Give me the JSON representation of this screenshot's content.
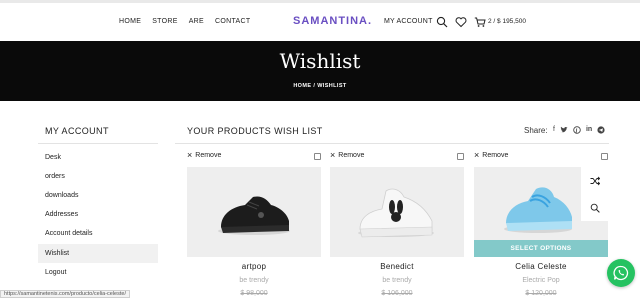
{
  "header": {
    "nav": [
      "HOME",
      "STORE",
      "ARE",
      "CONTACT"
    ],
    "logo": "SAMANTINA.",
    "account_label": "MY ACCOUNT",
    "cart_summary": "2 / $ 195,500"
  },
  "banner": {
    "title": "Wishlist",
    "breadcrumb": "HOME  /  WISHLIST"
  },
  "sidebar": {
    "title": "MY ACCOUNT",
    "items": [
      {
        "label": "Desk"
      },
      {
        "label": "orders"
      },
      {
        "label": "downloads"
      },
      {
        "label": "Addresses"
      },
      {
        "label": "Account details"
      },
      {
        "label": "Wishlist",
        "active": true
      },
      {
        "label": "Logout"
      }
    ]
  },
  "main": {
    "title": "YOUR PRODUCTS WISH LIST",
    "share_label": "Share:",
    "share_icons": [
      "facebook-icon",
      "twitter-icon",
      "pinterest-icon",
      "linkedin-icon",
      "telegram-icon"
    ],
    "remove_label": "Remove",
    "products": [
      {
        "name": "artpop",
        "category": "be trendy",
        "price": "$ 98,000",
        "shoe_color": "#1c1c1c"
      },
      {
        "name": "Benedict",
        "category": "be trendy",
        "price": "$ 106,000",
        "shoe_color": "#f5f5f5"
      },
      {
        "name": "Celia Celeste",
        "category": "Electric Pop",
        "price": "$ 120,000",
        "shoe_color": "#7ec8ea",
        "select_options": "SELECT OPTIONS"
      }
    ]
  },
  "statusbar": {
    "url": "https://samantinetenis.com/producto/celia-celeste/"
  },
  "colors": {
    "brand": "#6a4fc2",
    "banner_bg": "#0a0a0a",
    "accent": "#83c9c9",
    "whatsapp": "#25c261"
  }
}
